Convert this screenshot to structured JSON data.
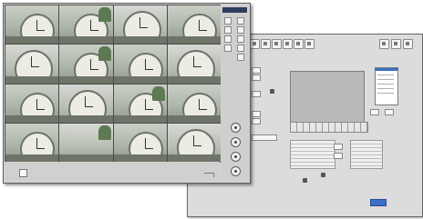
{
  "settings_window": {
    "toolbar_icons": [
      "camera-icon",
      "record-icon",
      "schedule-icon",
      "network-icon",
      "user-icon",
      "config-icon"
    ],
    "right_icons": [
      "help-icon",
      "minimize-icon",
      "close-icon"
    ],
    "ok_label": ""
  },
  "live_window": {
    "camera_tiles": 16,
    "selected_tile": 1,
    "panel_title": "",
    "control_icons": [
      "ptz-icon",
      "zoom-icon",
      "focus-icon",
      "iris-icon"
    ]
  },
  "colors": {
    "accent": "#3b6fc8",
    "panel_header": "#2e3d5e",
    "selection": "#e07a2a"
  }
}
